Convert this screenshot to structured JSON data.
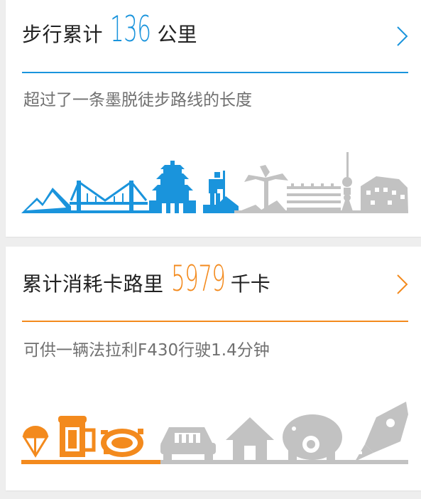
{
  "cards": [
    {
      "label": "步行累计",
      "value": "136",
      "unit": "公里",
      "description": "超过了一条墨脱徒步路线的长度",
      "accent_color": "#1a94dc",
      "icon": "chevron-right-icon",
      "progress_fraction": 0.56,
      "scene_icons": [
        "mountain-icon",
        "bridge-icon",
        "temple-icon",
        "hiker-icon",
        "palm-tree-icon",
        "waves-icon",
        "tv-tower-icon",
        "palace-icon"
      ]
    },
    {
      "label": "累计消耗卡路里",
      "value": "5979",
      "unit": "千卡",
      "description": "可供一辆法拉利F430行驶1.4分钟",
      "accent_color": "#f38a1d",
      "icon": "chevron-right-icon",
      "progress_fraction": 0.36,
      "scene_icons": [
        "ice-cream-icon",
        "beer-mug-icon",
        "roast-chicken-icon",
        "car-icon",
        "house-icon",
        "elephant-icon",
        "rocket-icon"
      ]
    }
  ],
  "inactive_color": "#c2c2c2"
}
